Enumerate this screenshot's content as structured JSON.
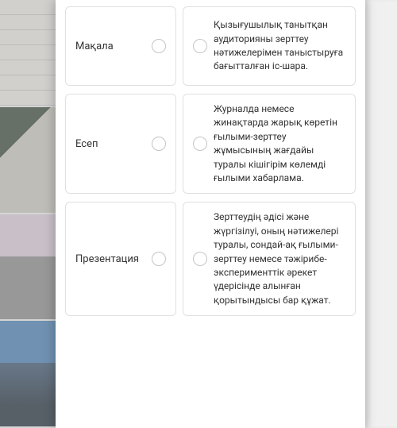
{
  "matching": {
    "left_items": [
      {
        "label": "Мақала"
      },
      {
        "label": "Есеп"
      },
      {
        "label": "Презентация"
      }
    ],
    "right_items": [
      {
        "text": "Қызығушылық танытқан аудиторияны зерттеу нәтижелерімен таныстыруға бағытталған іс-шара."
      },
      {
        "text": "Журналда немесе жинақтарда жарық көретін ғылыми-зерттеу жұмысының жағдайы туралы кішігірім көлемді ғылыми хабарлама."
      },
      {
        "text": "Зерттеудің әдісі және жүргізілуі, оның нәтижелері туралы, сондай-ақ ғылыми-зерттеу немесе тәжірибе-эксперименттік әрекет үдерісінде алынған қорытындысы бар құжат."
      }
    ]
  }
}
